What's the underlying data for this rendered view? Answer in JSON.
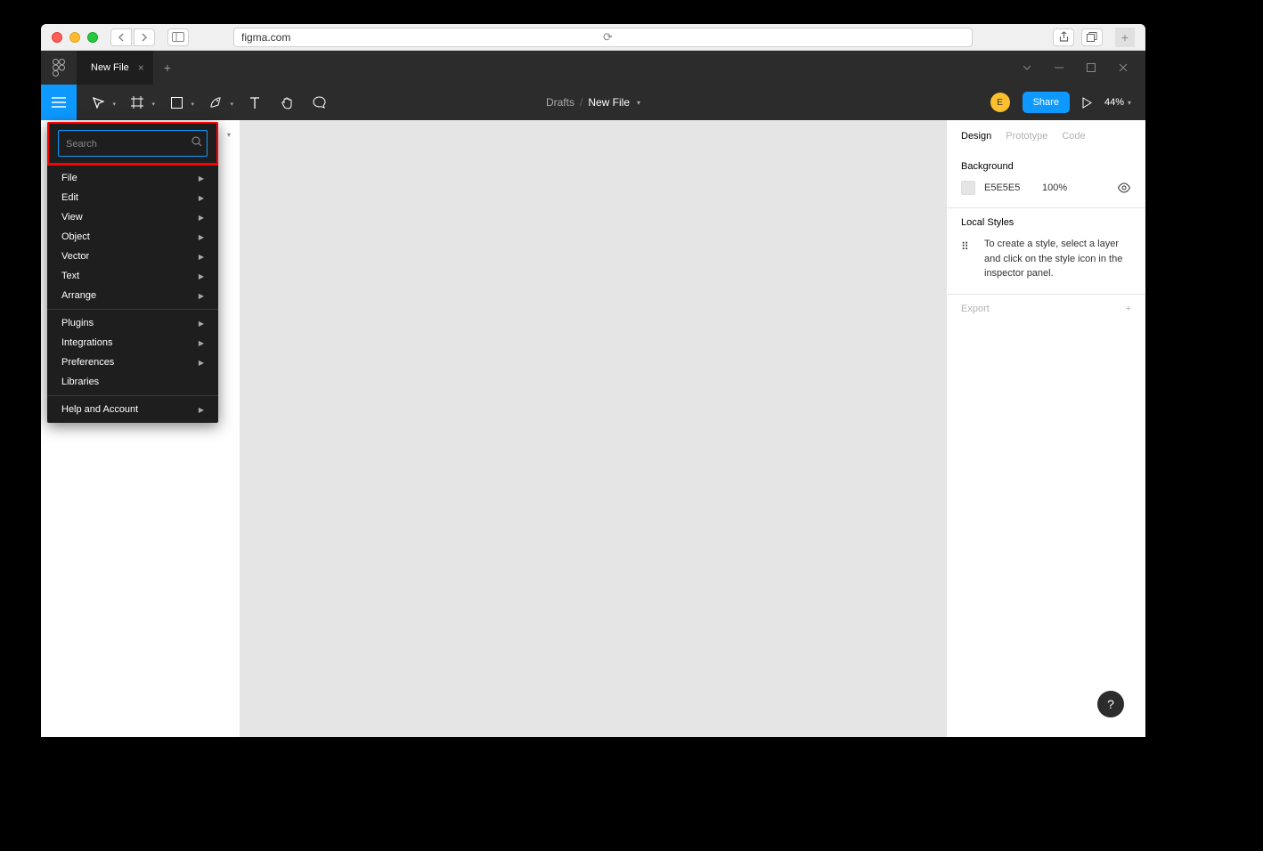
{
  "browser": {
    "url": "figma.com"
  },
  "tabs": {
    "active": "New File"
  },
  "breadcrumb": {
    "parent": "Drafts",
    "current": "New File"
  },
  "toolbar": {
    "share": "Share",
    "zoom": "44%",
    "avatar_initial": "E"
  },
  "menu": {
    "search_placeholder": "Search",
    "items_a": [
      "File",
      "Edit",
      "View",
      "Object",
      "Vector",
      "Text",
      "Arrange"
    ],
    "items_b": [
      "Plugins",
      "Integrations",
      "Preferences",
      "Libraries"
    ],
    "items_c": [
      "Help and Account"
    ]
  },
  "right_panel": {
    "tabs": {
      "design": "Design",
      "prototype": "Prototype",
      "code": "Code"
    },
    "background": {
      "title": "Background",
      "hex": "E5E5E5",
      "opacity": "100%"
    },
    "local_styles": {
      "title": "Local Styles",
      "hint": "To create a style, select a layer and click on the style icon in the inspector panel."
    },
    "export": "Export"
  },
  "help_label": "?"
}
